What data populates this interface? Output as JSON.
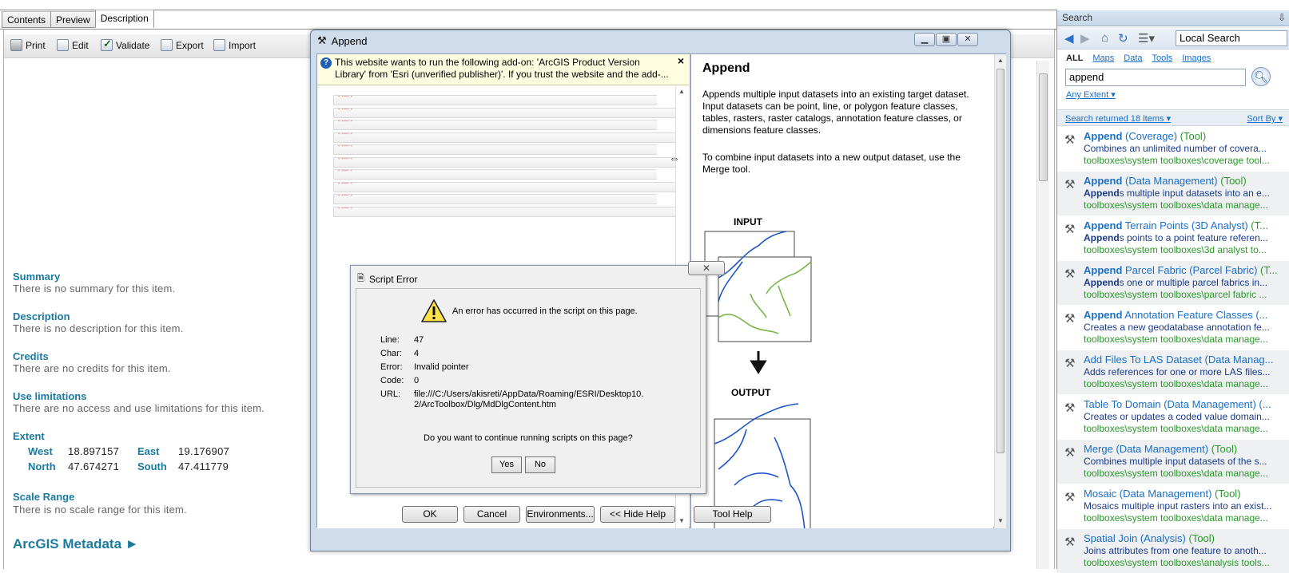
{
  "catalog": {
    "tabs": [
      "Contents",
      "Preview",
      "Description"
    ],
    "active_tab": "Description",
    "toolbar": {
      "print": "Print",
      "edit": "Edit",
      "validate": "Validate",
      "export": "Export",
      "import": "Import"
    },
    "sections": {
      "summary_title": "Summary",
      "summary_text": "There is no summary for this item.",
      "description_title": "Description",
      "description_text": "There is no description for this item.",
      "credits_title": "Credits",
      "credits_text": "There are no credits for this item.",
      "use_title": "Use limitations",
      "use_text": "There are no access and use limitations for this item.",
      "extent_title": "Extent",
      "scale_title": "Scale Range",
      "scale_text": "There is no scale range for this item.",
      "arcgis_metadata": "ArcGIS Metadata ►"
    },
    "extent": {
      "west_label": "West",
      "west": "18.897157",
      "east_label": "East",
      "east": "19.176907",
      "north_label": "North",
      "north": "47.674271",
      "south_label": "South",
      "south": "47.411779"
    }
  },
  "search": {
    "title": "Search",
    "pin": "⇩",
    "scope": "Local Search",
    "filters": [
      "ALL",
      "Maps",
      "Data",
      "Tools",
      "Images"
    ],
    "query": "append",
    "extent": "Any Extent ▾",
    "results_count": "Search returned 18 items ▾",
    "sort_by": "Sort By ▾",
    "results": [
      {
        "bold": "Append",
        "rest": " (Coverage)",
        "type": " (Tool)",
        "desc_bold": "",
        "desc": "Combines an unlimited number of covera...",
        "path": "toolboxes\\system toolboxes\\coverage tool..."
      },
      {
        "bold": "Append",
        "rest": " (Data Management)",
        "type": " (Tool)",
        "desc_bold": "Append",
        "desc": "s multiple input datasets into an e...",
        "path": "toolboxes\\system toolboxes\\data manage..."
      },
      {
        "bold": "Append",
        "rest": " Terrain Points (3D Analyst)",
        "type": " (T...",
        "desc_bold": "Append",
        "desc": "s points to a point feature referen...",
        "path": "toolboxes\\system toolboxes\\3d analyst to..."
      },
      {
        "bold": "Append",
        "rest": " Parcel Fabric (Parcel Fabric)",
        "type": " (T...",
        "desc_bold": "Append",
        "desc": "s one or multiple parcel fabrics in...",
        "path": "toolboxes\\system toolboxes\\parcel fabric ..."
      },
      {
        "bold": "Append",
        "rest": " Annotation Feature Classes (...",
        "type": "",
        "desc_bold": "",
        "desc": "Creates a new geodatabase annotation fe...",
        "path": "toolboxes\\system toolboxes\\data manage..."
      },
      {
        "bold": "",
        "rest": "Add Files To LAS Dataset (Data Manag...",
        "type": "",
        "desc_bold": "",
        "desc": "Adds references for one or more LAS files...",
        "path": "toolboxes\\system toolboxes\\data manage..."
      },
      {
        "bold": "",
        "rest": "Table To Domain (Data Management) (...",
        "type": "",
        "desc_bold": "",
        "desc": "Creates or updates a coded value domain...",
        "path": "toolboxes\\system toolboxes\\data manage..."
      },
      {
        "bold": "",
        "rest": "Merge (Data Management)",
        "type": " (Tool)",
        "desc_bold": "",
        "desc": "Combines multiple input datasets of the s...",
        "path": "toolboxes\\system toolboxes\\data manage..."
      },
      {
        "bold": "",
        "rest": "Mosaic (Data Management)",
        "type": " (Tool)",
        "desc_bold": "",
        "desc": "Mosaics multiple input rasters into an exist...",
        "path": "toolboxes\\system toolboxes\\data manage..."
      },
      {
        "bold": "",
        "rest": "Spatial Join (Analysis)",
        "type": " (Tool)",
        "desc_bold": "",
        "desc": "Joins attributes from one feature to anoth...",
        "path": "toolboxes\\system toolboxes\\analysis tools..."
      }
    ]
  },
  "append_dialog": {
    "title": "Append",
    "addon_message": "This website wants to run the following add-on: 'ArcGIS Product Version Library' from 'Esri (unverified publisher)'. If you trust the website and the add-...",
    "param_placeholder": "- ---- -",
    "help_title": "Append",
    "help_p1": "Appends multiple input datasets into an existing target dataset. Input datasets can be point, line, or polygon feature classes, tables, rasters, raster catalogs, annotation feature classes, or dimensions feature classes.",
    "help_p2": "To combine input datasets into a new output dataset, use the Merge tool.",
    "input_label": "INPUT",
    "output_label": "OUTPUT",
    "buttons": {
      "ok": "OK",
      "cancel": "Cancel",
      "environments": "Environments...",
      "hide_help": "<< Hide Help",
      "tool_help": "Tool Help"
    }
  },
  "script_error": {
    "title": "Script Error",
    "message": "An error has occurred in the script on this page.",
    "line_label": "Line:",
    "line": "47",
    "char_label": "Char:",
    "char": "4",
    "error_label": "Error:",
    "error": "Invalid pointer",
    "code_label": "Code:",
    "code": "0",
    "url_label": "URL:",
    "url_1": "file:///C:/Users/akisreti/AppData/Roaming/ESRI/Desktop10.",
    "url_2": "2/ArcToolbox/Dlg/MdDlgContent.htm",
    "question": "Do you want to continue running scripts on this page?",
    "yes": "Yes",
    "no": "No"
  },
  "colors": {
    "link": "#1a6fc9",
    "heading": "#1a7aa0",
    "path_green": "#2a9a2a",
    "map_line_blue": "#1f56c8",
    "map_line_green": "#7ab648"
  }
}
